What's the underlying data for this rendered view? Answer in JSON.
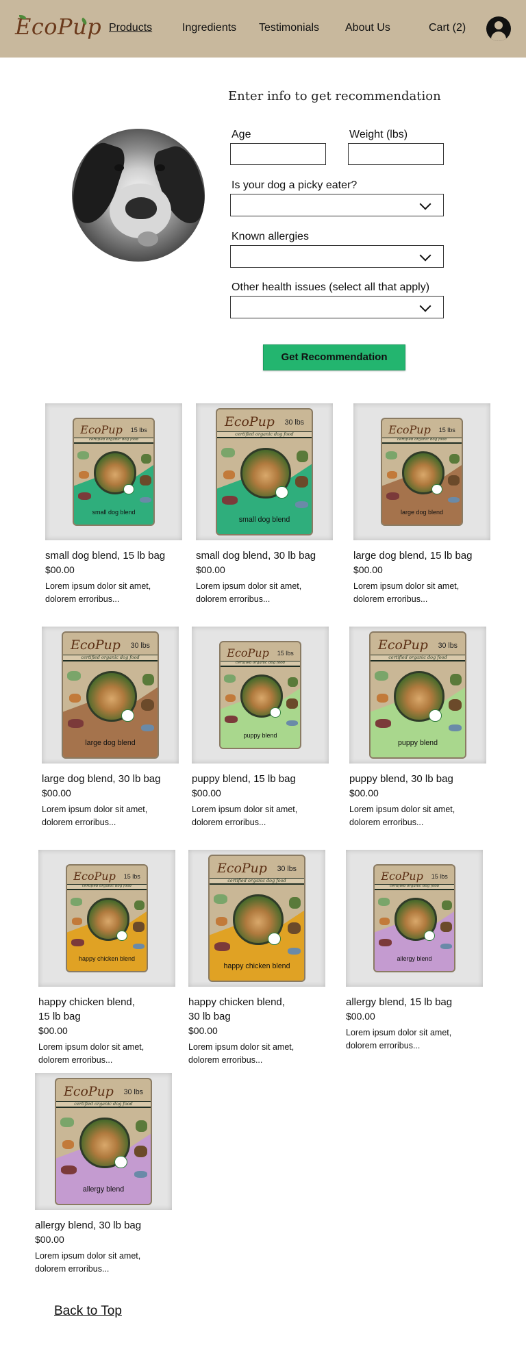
{
  "header": {
    "logo": "EcoPup",
    "nav": [
      "Products",
      "Ingredients",
      "Testimonials",
      "About Us"
    ],
    "cart": "Cart (2)",
    "accent": "#c8b89d"
  },
  "form": {
    "title": "Enter info to get recommendation",
    "age_label": "Age",
    "weight_label": "Weight (lbs)",
    "picky_label": "Is your dog a picky eater?",
    "allergies_label": "Known allergies",
    "health_label": "Other health issues (select all that apply)",
    "submit": "Get Recommendation",
    "submit_color": "#23b56f"
  },
  "bag_text": {
    "brand": "EcoPup",
    "tagline": "certified organic dog food",
    "badge": "USDA ORGANIC"
  },
  "products": [
    {
      "title": "small dog blend, 15 lb bag",
      "price": "$00.00",
      "desc": "Lorem ipsum dolor sit amet, dolorem erroribus...",
      "bag_size": "15 lbs",
      "blend_label": "small dog blend",
      "color": "#2fae7c"
    },
    {
      "title": "small dog blend, 30 lb bag",
      "price": "$00.00",
      "desc": "Lorem ipsum dolor sit amet, dolorem erroribus...",
      "bag_size": "30 lbs",
      "blend_label": "small dog blend",
      "color": "#2fae7c"
    },
    {
      "title": "large dog blend, 15 lb bag",
      "price": "$00.00",
      "desc": "Lorem ipsum dolor sit amet, dolorem erroribus...",
      "bag_size": "15 lbs",
      "blend_label": "large dog blend",
      "color": "#a5734c"
    },
    {
      "title": "large dog blend, 30 lb bag",
      "price": "$00.00",
      "desc": "Lorem ipsum dolor sit amet, dolorem erroribus...",
      "bag_size": "30 lbs",
      "blend_label": "large dog blend",
      "color": "#a5734c"
    },
    {
      "title": "puppy blend, 15 lb bag",
      "price": "$00.00",
      "desc": "Lorem ipsum dolor sit amet, dolorem erroribus...",
      "bag_size": "15 lbs",
      "blend_label": "puppy blend",
      "color": "#a9d78d"
    },
    {
      "title": "puppy blend, 30 lb bag",
      "price": "$00.00",
      "desc": "Lorem ipsum dolor sit amet, dolorem erroribus...",
      "bag_size": "30 lbs",
      "blend_label": "puppy blend",
      "color": "#a9d78d"
    },
    {
      "title": "happy chicken blend, 15 lb bag",
      "price": "$00.00",
      "desc": "Lorem ipsum dolor sit amet, dolorem erroribus...",
      "bag_size": "15 lbs",
      "blend_label": "happy chicken blend",
      "color": "#e0a224"
    },
    {
      "title": "happy chicken blend, 30 lb bag",
      "price": "$00.00",
      "desc": "Lorem ipsum dolor sit amet, dolorem erroribus...",
      "bag_size": "30 lbs",
      "blend_label": "happy chicken blend",
      "color": "#e0a224"
    },
    {
      "title": "allergy blend, 15 lb bag",
      "price": "$00.00",
      "desc": "Lorem ipsum dolor sit amet, dolorem erroribus...",
      "bag_size": "15 lbs",
      "blend_label": "allergy blend",
      "color": "#c49bd0"
    },
    {
      "title": "allergy blend, 30 lb bag",
      "price": "$00.00",
      "desc": "Lorem ipsum dolor sit amet, dolorem erroribus...",
      "bag_size": "30 lbs",
      "blend_label": "allergy blend",
      "color": "#c49bd0"
    }
  ],
  "footer": {
    "back_to_top": "Back to Top"
  }
}
